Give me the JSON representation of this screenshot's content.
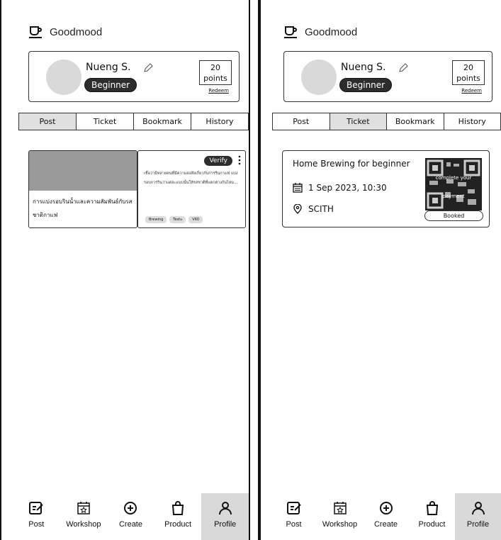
{
  "app": {
    "name": "Goodmood"
  },
  "user": {
    "name": "Nueng S.",
    "level": "Beginner",
    "points_value": "20",
    "points_unit": "points",
    "redeem_label": "Redeem"
  },
  "tabs": [
    "Post",
    "Ticket",
    "Bookmark",
    "History"
  ],
  "left_screen": {
    "active_tab": "Post"
  },
  "right_screen": {
    "active_tab": "Ticket"
  },
  "post": {
    "title_line1": "การแบ่งรอบรินน้ำและความสัมพันธ์กับรส",
    "title_line2": "ชาติกาแฟ",
    "badge": "Verify",
    "excerpt": "เชื่อว่ามีหลายคนที่มีความสงสัยเกี่ยวกับการรินกาแฟ แบ่งรอบการรินว่าแต่ละแบบนั้นให้รสชาติที่แตกต่างกันไหม...",
    "tags": [
      "Brewing",
      "Testu",
      "V60"
    ]
  },
  "ticket": {
    "title": "Home Brewing for beginner",
    "datetime": "1 Sep 2023, 10:30",
    "location": "SCITH",
    "qr_overlay_line1": "complete your",
    "qr_overlay_line2": "payment",
    "status": "Booked"
  },
  "nav": [
    {
      "label": "Post",
      "icon": "post-edit-icon"
    },
    {
      "label": "Workshop",
      "icon": "calendar-star-icon"
    },
    {
      "label": "Create",
      "icon": "plus-circle-icon"
    },
    {
      "label": "Product",
      "icon": "shopping-bag-icon"
    },
    {
      "label": "Profile",
      "icon": "person-icon"
    }
  ],
  "nav_active": "Profile"
}
